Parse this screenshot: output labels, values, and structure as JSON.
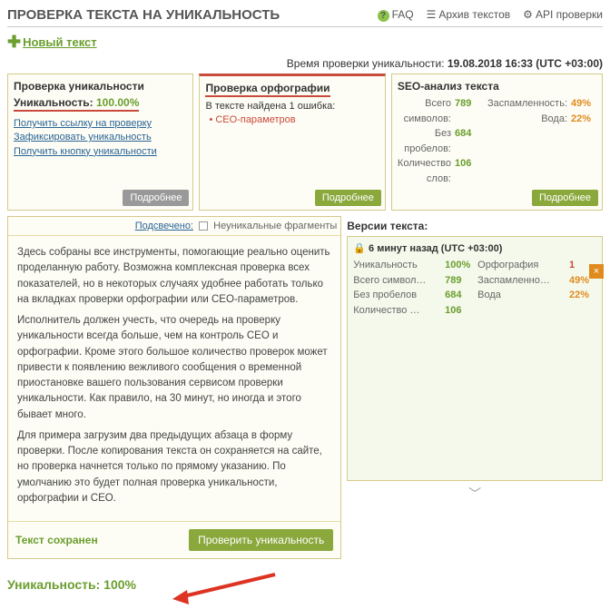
{
  "header": {
    "title": "ПРОВЕРКА ТЕКСТА НА УНИКАЛЬНОСТЬ",
    "faq": "FAQ",
    "archive": "Архив текстов",
    "api": "API проверки"
  },
  "newText": "Новый текст",
  "timeRow": {
    "label": "Время проверки уникальности:",
    "value": "19.08.2018 16:33 (UTC +03:00)"
  },
  "panel1": {
    "title": "Проверка уникальности",
    "uniqLabel": "Уникальность:",
    "uniqVal": "100.00%",
    "links": [
      "Получить ссылку на проверку",
      "Зафиксировать уникальность",
      "Получить кнопку уникальности"
    ],
    "more": "Подробнее"
  },
  "panel2": {
    "title": "Проверка орфографии",
    "errText": "В тексте найдена 1 ошибка:",
    "errItem": "• СЕО-параметров",
    "more": "Подробнее"
  },
  "panel3": {
    "title": "SEO-анализ текста",
    "left": [
      {
        "l": "Всего символов:",
        "v": "789"
      },
      {
        "l": "Без пробелов:",
        "v": "684"
      },
      {
        "l": "Количество слов:",
        "v": "106"
      }
    ],
    "right": [
      {
        "l": "Заспамленность:",
        "v": "49%"
      },
      {
        "l": "Вода:",
        "v": "22%"
      }
    ],
    "more": "Подробнее"
  },
  "legend": {
    "linked": "Подсвечено:",
    "frag": "Неуникальные фрагменты"
  },
  "textBody": [
    "Здесь собраны все инструменты, помогающие реально оценить проделанную работу. Возможна комплексная проверка всех показателей, но в некоторых случаях удобнее работать только на вкладках проверки орфографии или СЕО-параметров.",
    "Исполнитель должен учесть, что очередь на проверку уникальности всегда больше, чем на контроль СЕО и орфографии. Кроме этого большое количество проверок может привести к появлению вежливого сообщения о временной приостановке вашего пользования сервисом проверки уникальности. Как правило, на 30 минут, но иногда и этого бывает много.",
    "Для примера загрузим два предыдущих абзаца в форму проверки. После копирования текста он сохраняется на сайте, но проверка начнется только по прямому указанию. По умолчанию это будет полная проверка уникальности, орфографии и СЕО."
  ],
  "saved": "Текст сохранен",
  "checkBtn": "Проверить уникальность",
  "versions": {
    "title": "Версии текста:",
    "time": "🔒 6 минут назад  (UTC +03:00)",
    "left": [
      {
        "l": "Уникальность",
        "v": "100%",
        "c": "green"
      },
      {
        "l": "Всего символ…",
        "v": "789",
        "c": "green"
      },
      {
        "l": "Без пробелов",
        "v": "684",
        "c": "green"
      },
      {
        "l": "Количество …",
        "v": "106",
        "c": "green"
      }
    ],
    "right": [
      {
        "l": "Орфография",
        "v": "1",
        "c": "red"
      },
      {
        "l": "Заспамленно…",
        "v": "49%",
        "c": "orange"
      },
      {
        "l": "Вода",
        "v": "22%",
        "c": "orange"
      }
    ]
  },
  "footer": "Уникальность: 100%"
}
